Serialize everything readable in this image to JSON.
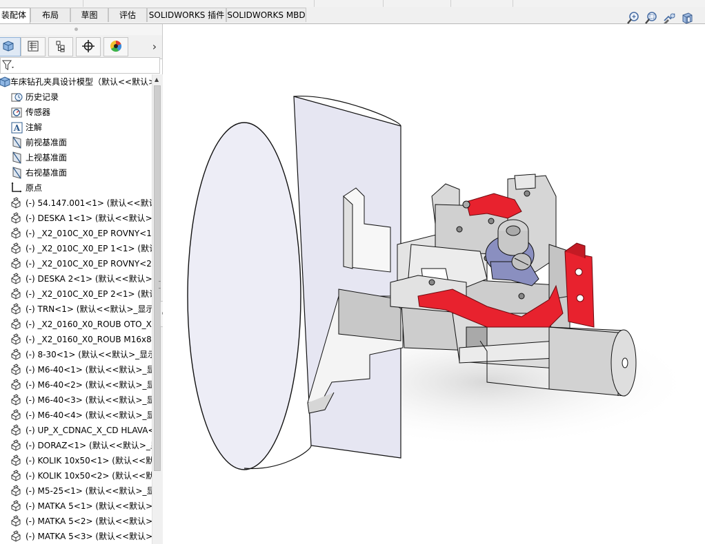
{
  "tabs": [
    {
      "label": "装配体",
      "active": true
    },
    {
      "label": "布局",
      "active": false
    },
    {
      "label": "草图",
      "active": false
    },
    {
      "label": "评估",
      "active": false
    },
    {
      "label": "SOLIDWORKS 插件",
      "active": false
    },
    {
      "label": "SOLIDWORKS MBD",
      "active": false
    }
  ],
  "manager_tabs": [
    "featuremanager-icon",
    "propertymanager-icon",
    "configurationmanager-icon",
    "dimxpert-icon",
    "displaymanager-icon"
  ],
  "tree": {
    "root": "车床钻孔夹具设计模型（默认<<默认>",
    "items": [
      {
        "label": "历史记录",
        "icon": "history-icon"
      },
      {
        "label": "传感器",
        "icon": "sensor-icon"
      },
      {
        "label": "注解",
        "icon": "annotation-icon"
      },
      {
        "label": "前视基准面",
        "icon": "plane-icon"
      },
      {
        "label": "上视基准面",
        "icon": "plane-icon"
      },
      {
        "label": "右视基准面",
        "icon": "plane-icon"
      },
      {
        "label": "原点",
        "icon": "origin-icon"
      }
    ],
    "components": [
      "(-) 54.147.001<1> (默认<<默认>",
      "(-) DESKA 1<1> (默认<<默认>_显",
      "(-) _X2_010C_X0_EP ROVNY<1> (默认<",
      "(-) _X2_010C_X0_EP 1<1> (默认<<",
      "(-) _X2_010C_X0_EP ROVNY<2> (默认<",
      "(-) DESKA 2<1> (默认<<默认>_显",
      "(-) _X2_010C_X0_EP 2<1> (默认<<",
      "(-) TRN<1> (默认<<默认>_显示",
      "(-) _X2_0160_X0_ROUB OTO_X2",
      "(-) _X2_0160_X0_ROUB M16x80",
      "(-) 8-30<1> (默认<<默认>_显示",
      "(-) M6-40<1> (默认<<默认>_显",
      "(-) M6-40<2> (默认<<默认>_显",
      "(-) M6-40<3> (默认<<默认>_显",
      "(-) M6-40<4> (默认<<默认>_显",
      "(-) UP_X_CDNAC_X_CD HLAVA<",
      "(-) DORAZ<1> (默认<<默认>_显",
      "(-) KOLIK 10x50<1> (默认<<默认",
      "(-) KOLIK 10x50<2> (默认<<默认",
      "(-) M5-25<1> (默认<<默认>_显",
      "(-) MATKA 5<1> (默认<<默认>_",
      "(-) MATKA 5<2> (默认<<默认>_",
      "(-) MATKA 5<3> (默认<<默认>_"
    ]
  },
  "hud_icons": [
    "zoom-to-fit-icon",
    "zoom-to-area-icon",
    "previous-view-icon",
    "section-view-icon"
  ],
  "colors": {
    "accent_red": "#e8222e",
    "part_gray": "#cfcfcf",
    "part_blue": "#8a8fc0"
  }
}
